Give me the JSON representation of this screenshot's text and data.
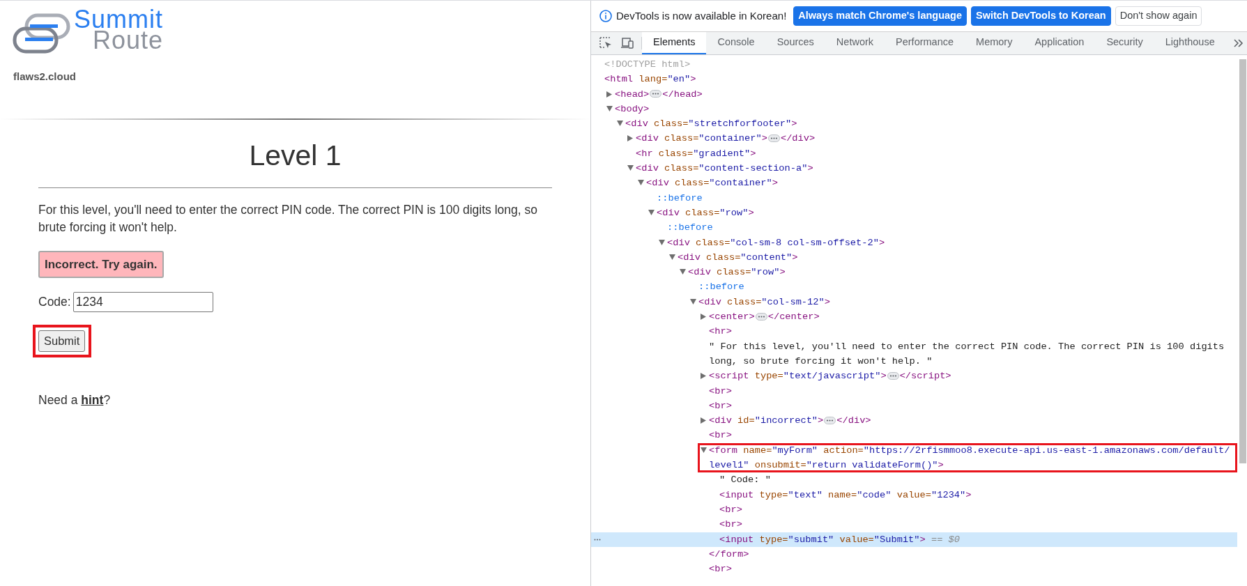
{
  "page": {
    "logo": {
      "line_1": "Summit",
      "line_2": "Route"
    },
    "site_name": "flaws2.cloud",
    "heading": "Level 1",
    "intro": "For this level, you'll need to enter the correct PIN code. The correct PIN is 100 digits long, so brute forcing it won't help.",
    "alert": "Incorrect. Try again.",
    "code_label": "Code:",
    "code_value": "1234",
    "submit": {
      "label": "Submit",
      "annotated": true
    },
    "hint": {
      "before": "Need a ",
      "link": "hint",
      "after": "?"
    }
  },
  "devtools": {
    "notice": {
      "message": "DevTools is now available in Korean!",
      "buttons": [
        {
          "label": "Always match Chrome's language",
          "kind": "primary"
        },
        {
          "label": "Switch DevTools to Korean",
          "kind": "primary"
        },
        {
          "label": "Don't show again",
          "kind": "secondary"
        }
      ]
    },
    "tabs": [
      {
        "label": "Elements",
        "selected": true
      },
      {
        "label": "Console",
        "selected": false
      },
      {
        "label": "Sources",
        "selected": false
      },
      {
        "label": "Network",
        "selected": false
      },
      {
        "label": "Performance",
        "selected": false
      },
      {
        "label": "Memory",
        "selected": false
      },
      {
        "label": "Application",
        "selected": false
      },
      {
        "label": "Security",
        "selected": false
      },
      {
        "label": "Lighthouse",
        "selected": false
      }
    ],
    "tree": [
      {
        "parts": [
          {
            "kind": "doctype",
            "text": "<!DOCTYPE html>"
          }
        ],
        "selected": false
      },
      {
        "parts": [
          {
            "kind": "tag",
            "text": "<html"
          },
          {
            "kind": "attr",
            "text": " lang="
          },
          {
            "kind": "value",
            "text": "\"en\""
          },
          {
            "kind": "tag",
            "text": ">"
          }
        ],
        "selected": false,
        "children": [
          {
            "parts": [
              {
                "kind": "tag",
                "text": "<head>"
              },
              {
                "kind": "ellipsis"
              },
              {
                "kind": "tag",
                "text": "</head>"
              }
            ],
            "expanded": false,
            "selected": false
          },
          {
            "parts": [
              {
                "kind": "tag",
                "text": "<body>"
              }
            ],
            "expanded": true,
            "selected": false,
            "children": [
              {
                "parts": [
                  {
                    "kind": "tag",
                    "text": "<div"
                  },
                  {
                    "kind": "attr",
                    "text": " class="
                  },
                  {
                    "kind": "value",
                    "text": "\"stretchforfooter\""
                  },
                  {
                    "kind": "tag",
                    "text": ">"
                  }
                ],
                "expanded": true,
                "selected": false,
                "children": [
                  {
                    "parts": [
                      {
                        "kind": "tag",
                        "text": "<div"
                      },
                      {
                        "kind": "attr",
                        "text": " class="
                      },
                      {
                        "kind": "value",
                        "text": "\"container\""
                      },
                      {
                        "kind": "tag",
                        "text": ">"
                      },
                      {
                        "kind": "ellipsis"
                      },
                      {
                        "kind": "tag",
                        "text": "</div>"
                      }
                    ],
                    "expanded": false,
                    "selected": false
                  },
                  {
                    "parts": [
                      {
                        "kind": "tag",
                        "text": "<hr"
                      },
                      {
                        "kind": "attr",
                        "text": " class="
                      },
                      {
                        "kind": "value",
                        "text": "\"gradient\""
                      },
                      {
                        "kind": "tag",
                        "text": ">"
                      }
                    ],
                    "selected": false
                  },
                  {
                    "parts": [
                      {
                        "kind": "tag",
                        "text": "<div"
                      },
                      {
                        "kind": "attr",
                        "text": " class="
                      },
                      {
                        "kind": "value",
                        "text": "\"content-section-a\""
                      },
                      {
                        "kind": "tag",
                        "text": ">"
                      }
                    ],
                    "expanded": true,
                    "selected": false,
                    "children": [
                      {
                        "parts": [
                          {
                            "kind": "tag",
                            "text": "<div"
                          },
                          {
                            "kind": "attr",
                            "text": " class="
                          },
                          {
                            "kind": "value",
                            "text": "\"container\""
                          },
                          {
                            "kind": "tag",
                            "text": ">"
                          }
                        ],
                        "expanded": true,
                        "selected": false,
                        "children": [
                          {
                            "parts": [
                              {
                                "kind": "pseudo",
                                "text": "::before"
                              }
                            ],
                            "selected": false
                          },
                          {
                            "parts": [
                              {
                                "kind": "tag",
                                "text": "<div"
                              },
                              {
                                "kind": "attr",
                                "text": " class="
                              },
                              {
                                "kind": "value",
                                "text": "\"row\""
                              },
                              {
                                "kind": "tag",
                                "text": ">"
                              }
                            ],
                            "expanded": true,
                            "selected": false,
                            "children": [
                              {
                                "parts": [
                                  {
                                    "kind": "pseudo",
                                    "text": "::before"
                                  }
                                ],
                                "selected": false
                              },
                              {
                                "parts": [
                                  {
                                    "kind": "tag",
                                    "text": "<div"
                                  },
                                  {
                                    "kind": "attr",
                                    "text": " class="
                                  },
                                  {
                                    "kind": "value",
                                    "text": "\"col-sm-8 col-sm-offset-2\""
                                  },
                                  {
                                    "kind": "tag",
                                    "text": ">"
                                  }
                                ],
                                "expanded": true,
                                "selected": false,
                                "children": [
                                  {
                                    "parts": [
                                      {
                                        "kind": "tag",
                                        "text": "<div"
                                      },
                                      {
                                        "kind": "attr",
                                        "text": " class="
                                      },
                                      {
                                        "kind": "value",
                                        "text": "\"content\""
                                      },
                                      {
                                        "kind": "tag",
                                        "text": ">"
                                      }
                                    ],
                                    "expanded": true,
                                    "selected": false,
                                    "children": [
                                      {
                                        "parts": [
                                          {
                                            "kind": "tag",
                                            "text": "<div"
                                          },
                                          {
                                            "kind": "attr",
                                            "text": " class="
                                          },
                                          {
                                            "kind": "value",
                                            "text": "\"row\""
                                          },
                                          {
                                            "kind": "tag",
                                            "text": ">"
                                          }
                                        ],
                                        "expanded": true,
                                        "selected": false,
                                        "children": [
                                          {
                                            "parts": [
                                              {
                                                "kind": "pseudo",
                                                "text": "::before"
                                              }
                                            ],
                                            "selected": false
                                          },
                                          {
                                            "parts": [
                                              {
                                                "kind": "tag",
                                                "text": "<div"
                                              },
                                              {
                                                "kind": "attr",
                                                "text": " class="
                                              },
                                              {
                                                "kind": "value",
                                                "text": "\"col-sm-12\""
                                              },
                                              {
                                                "kind": "tag",
                                                "text": ">"
                                              }
                                            ],
                                            "expanded": true,
                                            "selected": false,
                                            "children": [
                                              {
                                                "parts": [
                                                  {
                                                    "kind": "tag",
                                                    "text": "<center>"
                                                  },
                                                  {
                                                    "kind": "ellipsis"
                                                  },
                                                  {
                                                    "kind": "tag",
                                                    "text": "</center>"
                                                  }
                                                ],
                                                "expanded": false,
                                                "selected": false
                                              },
                                              {
                                                "parts": [
                                                  {
                                                    "kind": "tag",
                                                    "text": "<hr>"
                                                  }
                                                ],
                                                "selected": false
                                              },
                                              {
                                                "parts": [
                                                  {
                                                    "kind": "text",
                                                    "text": "\" For this level, you'll need to enter the correct PIN code. The correct PIN is 100 digits long, so brute forcing it won't help. \""
                                                  }
                                                ],
                                                "selected": false
                                              },
                                              {
                                                "parts": [
                                                  {
                                                    "kind": "tag",
                                                    "text": "<script"
                                                  },
                                                  {
                                                    "kind": "attr",
                                                    "text": " type="
                                                  },
                                                  {
                                                    "kind": "value",
                                                    "text": "\"text/javascript\""
                                                  },
                                                  {
                                                    "kind": "tag",
                                                    "text": ">"
                                                  },
                                                  {
                                                    "kind": "ellipsis"
                                                  },
                                                  {
                                                    "kind": "tag",
                                                    "text": "</script>"
                                                  }
                                                ],
                                                "expanded": false,
                                                "selected": false
                                              },
                                              {
                                                "parts": [
                                                  {
                                                    "kind": "tag",
                                                    "text": "<br>"
                                                  }
                                                ],
                                                "selected": false
                                              },
                                              {
                                                "parts": [
                                                  {
                                                    "kind": "tag",
                                                    "text": "<br>"
                                                  }
                                                ],
                                                "selected": false
                                              },
                                              {
                                                "parts": [
                                                  {
                                                    "kind": "tag",
                                                    "text": "<div"
                                                  },
                                                  {
                                                    "kind": "attr",
                                                    "text": " id="
                                                  },
                                                  {
                                                    "kind": "value",
                                                    "text": "\"incorrect\""
                                                  },
                                                  {
                                                    "kind": "tag",
                                                    "text": ">"
                                                  },
                                                  {
                                                    "kind": "ellipsis"
                                                  },
                                                  {
                                                    "kind": "tag",
                                                    "text": "</div>"
                                                  }
                                                ],
                                                "expanded": false,
                                                "selected": false
                                              },
                                              {
                                                "parts": [
                                                  {
                                                    "kind": "tag",
                                                    "text": "<br>"
                                                  }
                                                ],
                                                "selected": false
                                              },
                                              {
                                                "parts": [
                                                  {
                                                    "kind": "tag",
                                                    "text": "<form"
                                                  },
                                                  {
                                                    "kind": "attr",
                                                    "text": " name="
                                                  },
                                                  {
                                                    "kind": "value",
                                                    "text": "\"myForm\""
                                                  },
                                                  {
                                                    "kind": "attr",
                                                    "text": " action="
                                                  },
                                                  {
                                                    "kind": "value",
                                                    "text": "\"https://2rfismmoo8.execute-api.us-east-1.amazonaws.com/default/level1\""
                                                  },
                                                  {
                                                    "kind": "attr",
                                                    "text": " onsubmit="
                                                  },
                                                  {
                                                    "kind": "value",
                                                    "text": "\"return validateForm()\""
                                                  },
                                                  {
                                                    "kind": "tag",
                                                    "text": ">"
                                                  }
                                                ],
                                                "expanded": true,
                                                "annotated": true,
                                                "selected": false,
                                                "close": [
                                                  {
                                                    "kind": "tag",
                                                    "text": "</form>"
                                                  }
                                                ],
                                                "children": [
                                                  {
                                                    "parts": [
                                                      {
                                                        "kind": "text",
                                                        "text": "\" Code: \""
                                                      }
                                                    ],
                                                    "selected": false
                                                  },
                                                  {
                                                    "parts": [
                                                      {
                                                        "kind": "tag",
                                                        "text": "<input"
                                                      },
                                                      {
                                                        "kind": "attr",
                                                        "text": " type="
                                                      },
                                                      {
                                                        "kind": "value",
                                                        "text": "\"text\""
                                                      },
                                                      {
                                                        "kind": "attr",
                                                        "text": " name="
                                                      },
                                                      {
                                                        "kind": "value",
                                                        "text": "\"code\""
                                                      },
                                                      {
                                                        "kind": "attr",
                                                        "text": " value="
                                                      },
                                                      {
                                                        "kind": "value",
                                                        "text": "\"1234\""
                                                      },
                                                      {
                                                        "kind": "tag",
                                                        "text": ">"
                                                      }
                                                    ],
                                                    "selected": false
                                                  },
                                                  {
                                                    "parts": [
                                                      {
                                                        "kind": "tag",
                                                        "text": "<br>"
                                                      }
                                                    ],
                                                    "selected": false
                                                  },
                                                  {
                                                    "parts": [
                                                      {
                                                        "kind": "tag",
                                                        "text": "<br>"
                                                      }
                                                    ],
                                                    "selected": false
                                                  },
                                                  {
                                                    "parts": [
                                                      {
                                                        "kind": "tag",
                                                        "text": "<input"
                                                      },
                                                      {
                                                        "kind": "attr",
                                                        "text": " type="
                                                      },
                                                      {
                                                        "kind": "value",
                                                        "text": "\"submit\""
                                                      },
                                                      {
                                                        "kind": "attr",
                                                        "text": " value="
                                                      },
                                                      {
                                                        "kind": "value",
                                                        "text": "\"Submit\""
                                                      },
                                                      {
                                                        "kind": "tag",
                                                        "text": ">"
                                                      },
                                                      {
                                                        "kind": "dim",
                                                        "text": " == $0"
                                                      }
                                                    ],
                                                    "selected": true
                                                  }
                                                ]
                                              },
                                              {
                                                "parts": [
                                                  {
                                                    "kind": "tag",
                                                    "text": "<br>"
                                                  }
                                                ],
                                                "selected": false
                                              }
                                            ]
                                          }
                                        ]
                                      }
                                    ]
                                  }
                                ]
                              }
                            ]
                          }
                        ]
                      }
                    ]
                  }
                ]
              }
            ]
          }
        ]
      }
    ]
  }
}
